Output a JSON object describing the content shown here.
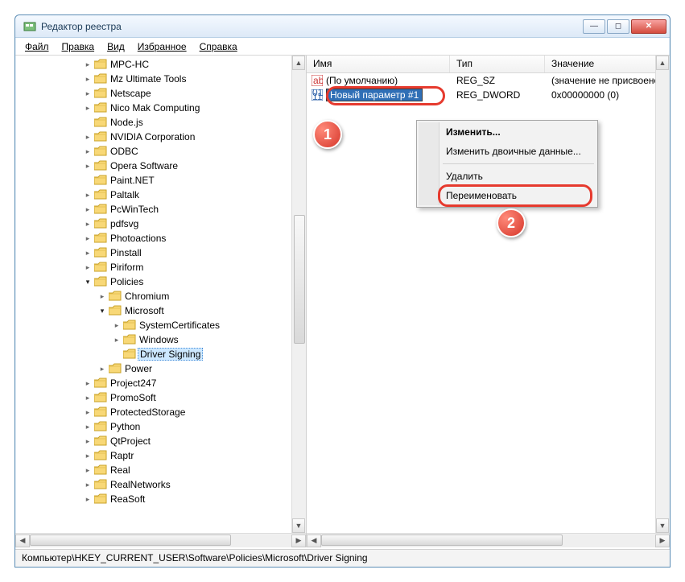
{
  "window": {
    "title": "Редактор реестра"
  },
  "menu": {
    "file": "Файл",
    "edit": "Правка",
    "view": "Вид",
    "favorites": "Избранное",
    "help": "Справка"
  },
  "tree": {
    "items": [
      {
        "label": "MPC-HC",
        "indent": 3,
        "exp": "closed"
      },
      {
        "label": "Mz Ultimate Tools",
        "indent": 3,
        "exp": "closed"
      },
      {
        "label": "Netscape",
        "indent": 3,
        "exp": "closed"
      },
      {
        "label": "Nico Mak Computing",
        "indent": 3,
        "exp": "closed"
      },
      {
        "label": "Node.js",
        "indent": 3,
        "exp": "none"
      },
      {
        "label": "NVIDIA Corporation",
        "indent": 3,
        "exp": "closed"
      },
      {
        "label": "ODBC",
        "indent": 3,
        "exp": "closed"
      },
      {
        "label": "Opera Software",
        "indent": 3,
        "exp": "closed"
      },
      {
        "label": "Paint.NET",
        "indent": 3,
        "exp": "none"
      },
      {
        "label": "Paltalk",
        "indent": 3,
        "exp": "closed"
      },
      {
        "label": "PcWinTech",
        "indent": 3,
        "exp": "closed"
      },
      {
        "label": "pdfsvg",
        "indent": 3,
        "exp": "closed"
      },
      {
        "label": "Photoactions",
        "indent": 3,
        "exp": "closed"
      },
      {
        "label": "Pinstall",
        "indent": 3,
        "exp": "closed"
      },
      {
        "label": "Piriform",
        "indent": 3,
        "exp": "closed"
      },
      {
        "label": "Policies",
        "indent": 3,
        "exp": "open"
      },
      {
        "label": "Chromium",
        "indent": 4,
        "exp": "closed"
      },
      {
        "label": "Microsoft",
        "indent": 4,
        "exp": "open"
      },
      {
        "label": "SystemCertificates",
        "indent": 5,
        "exp": "closed"
      },
      {
        "label": "Windows",
        "indent": 5,
        "exp": "closed"
      },
      {
        "label": "Driver Signing",
        "indent": 5,
        "exp": "none",
        "selected": true
      },
      {
        "label": "Power",
        "indent": 4,
        "exp": "closed"
      },
      {
        "label": "Project247",
        "indent": 3,
        "exp": "closed"
      },
      {
        "label": "PromoSoft",
        "indent": 3,
        "exp": "closed"
      },
      {
        "label": "ProtectedStorage",
        "indent": 3,
        "exp": "closed"
      },
      {
        "label": "Python",
        "indent": 3,
        "exp": "closed"
      },
      {
        "label": "QtProject",
        "indent": 3,
        "exp": "closed"
      },
      {
        "label": "Raptr",
        "indent": 3,
        "exp": "closed"
      },
      {
        "label": "Real",
        "indent": 3,
        "exp": "closed"
      },
      {
        "label": "RealNetworks",
        "indent": 3,
        "exp": "closed"
      },
      {
        "label": "ReaSoft",
        "indent": 3,
        "exp": "closed"
      }
    ]
  },
  "list": {
    "columns": {
      "name": "Имя",
      "type": "Тип",
      "value": "Значение"
    },
    "rows": [
      {
        "icon": "sz",
        "name": "(По умолчанию)",
        "type": "REG_SZ",
        "value": "(значение не присвоено)"
      },
      {
        "icon": "dw",
        "name": "Новый параметр #1",
        "type": "REG_DWORD",
        "value": "0x00000000 (0)",
        "editing": true
      }
    ]
  },
  "context": {
    "modify": "Изменить...",
    "modify_binary": "Изменить двоичные данные...",
    "delete": "Удалить",
    "rename": "Переименовать"
  },
  "badges": {
    "one": "1",
    "two": "2"
  },
  "status": {
    "path": "Компьютер\\HKEY_CURRENT_USER\\Software\\Policies\\Microsoft\\Driver Signing"
  }
}
